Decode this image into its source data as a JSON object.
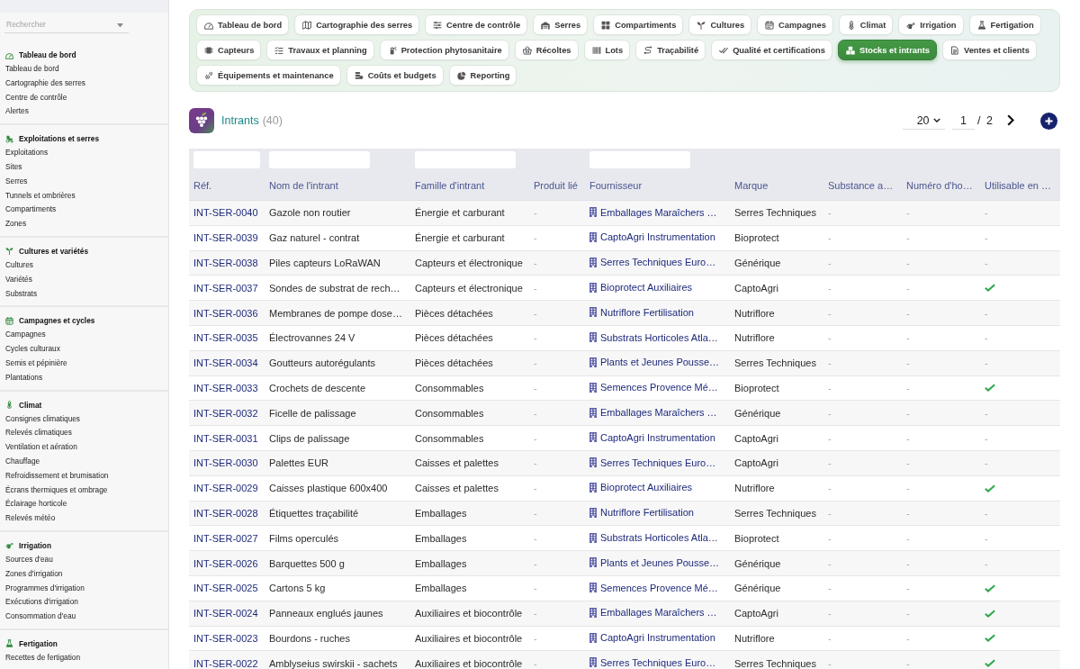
{
  "sidebar": {
    "search": {
      "placeholder": "Rechercher"
    },
    "sections": [
      {
        "title": "Tableau de bord",
        "items": [
          "Tableau de bord",
          "Cartographie des serres",
          "Centre de contrôle",
          "Alertes"
        ]
      },
      {
        "title": "Exploitations et serres",
        "items": [
          "Exploitations",
          "Sites",
          "Serres",
          "Tunnels et ombrières",
          "Compartiments",
          "Zones"
        ]
      },
      {
        "title": "Cultures et variétés",
        "items": [
          "Cultures",
          "Variétés",
          "Substrats"
        ]
      },
      {
        "title": "Campagnes et cycles",
        "items": [
          "Campagnes",
          "Cycles culturaux",
          "Semis et pépinière",
          "Plantations"
        ]
      },
      {
        "title": "Climat",
        "items": [
          "Consignes climatiques",
          "Relevés climatiques",
          "Ventilation et aération",
          "Chauffage",
          "Refroidissement et brumisation",
          "Écrans thermiques et ombrage",
          "Éclairage horticole",
          "Relevés météo"
        ]
      },
      {
        "title": "Irrigation",
        "items": [
          "Sources d'eau",
          "Zones d'irrigation",
          "Programmes d'irrigation",
          "Exécutions d'irrigation",
          "Consommation d'eau"
        ]
      },
      {
        "title": "Fertigation",
        "items": [
          "Recettes de fertigation"
        ]
      }
    ]
  },
  "nav_tabs": [
    {
      "label": "Tableau de bord",
      "selected": false
    },
    {
      "label": "Cartographie des serres",
      "selected": false
    },
    {
      "label": "Centre de contrôle",
      "selected": false
    },
    {
      "label": "Serres",
      "selected": false
    },
    {
      "label": "Compartiments",
      "selected": false
    },
    {
      "label": "Cultures",
      "selected": false
    },
    {
      "label": "Campagnes",
      "selected": false
    },
    {
      "label": "Climat",
      "selected": false
    },
    {
      "label": "Irrigation",
      "selected": false
    },
    {
      "label": "Fertigation",
      "selected": false
    },
    {
      "label": "Capteurs",
      "selected": false
    },
    {
      "label": "Travaux et planning",
      "selected": false
    },
    {
      "label": "Protection phytosanitaire",
      "selected": false
    },
    {
      "label": "Récoltes",
      "selected": false
    },
    {
      "label": "Lots",
      "selected": false
    },
    {
      "label": "Traçabilité",
      "selected": false
    },
    {
      "label": "Qualité et certifications",
      "selected": false
    },
    {
      "label": "Stocks et intrants",
      "selected": true
    },
    {
      "label": "Ventes et clients",
      "selected": false
    },
    {
      "label": "Équipements et maintenance",
      "selected": false
    },
    {
      "label": "Coûts et budgets",
      "selected": false
    },
    {
      "label": "Reporting",
      "selected": false
    }
  ],
  "header": {
    "title": "Intrants",
    "count": "(40)",
    "page_size": "20",
    "page": "1",
    "page_total": "/ 2"
  },
  "table": {
    "columns": [
      {
        "label": "Réf.",
        "filter": true
      },
      {
        "label": "Nom de l'intrant",
        "filter": true
      },
      {
        "label": "Famille d'intrant",
        "filter": true
      },
      {
        "label": "Produit lié",
        "filter": false
      },
      {
        "label": "Fournisseur",
        "filter": true
      },
      {
        "label": "Marque",
        "filter": false
      },
      {
        "label": "Substance a…",
        "filter": false
      },
      {
        "label": "Numéro d'ho…",
        "filter": false
      },
      {
        "label": "Utilisable en …",
        "filter": false
      }
    ],
    "rows": [
      {
        "ref": "INT-SER-0040",
        "name": "Gazole non routier",
        "family": "Énergie et carburant",
        "linked_product": "-",
        "supplier": "Emballages Maraîchers …",
        "brand": "Serres Techniques",
        "substance": "-",
        "number": "-",
        "usable": false,
        "usable_text": "-"
      },
      {
        "ref": "INT-SER-0039",
        "name": "Gaz naturel - contrat",
        "family": "Énergie et carburant",
        "linked_product": "-",
        "supplier": "CaptoAgri Instrumentation",
        "brand": "Bioprotect",
        "substance": "-",
        "number": "-",
        "usable": false,
        "usable_text": "-"
      },
      {
        "ref": "INT-SER-0038",
        "name": "Piles capteurs LoRaWAN",
        "family": "Capteurs et électronique",
        "linked_product": "-",
        "supplier": "Serres Techniques Euro…",
        "brand": "Générique",
        "substance": "-",
        "number": "-",
        "usable": false,
        "usable_text": "-"
      },
      {
        "ref": "INT-SER-0037",
        "name": "Sondes de substrat de rech…",
        "family": "Capteurs et électronique",
        "linked_product": "-",
        "supplier": "Bioprotect Auxiliaires",
        "brand": "CaptoAgri",
        "substance": "-",
        "number": "-",
        "usable": true
      },
      {
        "ref": "INT-SER-0036",
        "name": "Membranes de pompe dose…",
        "family": "Pièces détachées",
        "linked_product": "-",
        "supplier": "Nutriflore Fertilisation",
        "brand": "Nutriflore",
        "substance": "-",
        "number": "-",
        "usable": false,
        "usable_text": "-"
      },
      {
        "ref": "INT-SER-0035",
        "name": "Électrovannes 24 V",
        "family": "Pièces détachées",
        "linked_product": "-",
        "supplier": "Substrats Horticoles Atla…",
        "brand": "Nutriflore",
        "substance": "-",
        "number": "-",
        "usable": false,
        "usable_text": "-"
      },
      {
        "ref": "INT-SER-0034",
        "name": "Goutteurs autorégulants",
        "family": "Pièces détachées",
        "linked_product": "-",
        "supplier": "Plants et Jeunes Pousse…",
        "brand": "Serres Techniques",
        "substance": "-",
        "number": "-",
        "usable": false,
        "usable_text": "-"
      },
      {
        "ref": "INT-SER-0033",
        "name": "Crochets de descente",
        "family": "Consommables",
        "linked_product": "-",
        "supplier": "Semences Provence Mé…",
        "brand": "Bioprotect",
        "substance": "-",
        "number": "-",
        "usable": true
      },
      {
        "ref": "INT-SER-0032",
        "name": "Ficelle de palissage",
        "family": "Consommables",
        "linked_product": "-",
        "supplier": "Emballages Maraîchers …",
        "brand": "Générique",
        "substance": "-",
        "number": "-",
        "usable": false,
        "usable_text": "-"
      },
      {
        "ref": "INT-SER-0031",
        "name": "Clips de palissage",
        "family": "Consommables",
        "linked_product": "-",
        "supplier": "CaptoAgri Instrumentation",
        "brand": "CaptoAgri",
        "substance": "-",
        "number": "-",
        "usable": false,
        "usable_text": "-"
      },
      {
        "ref": "INT-SER-0030",
        "name": "Palettes EUR",
        "family": "Caisses et palettes",
        "linked_product": "-",
        "supplier": "Serres Techniques Euro…",
        "brand": "CaptoAgri",
        "substance": "-",
        "number": "-",
        "usable": false,
        "usable_text": "-"
      },
      {
        "ref": "INT-SER-0029",
        "name": "Caisses plastique 600x400",
        "family": "Caisses et palettes",
        "linked_product": "-",
        "supplier": "Bioprotect Auxiliaires",
        "brand": "Nutriflore",
        "substance": "-",
        "number": "-",
        "usable": true
      },
      {
        "ref": "INT-SER-0028",
        "name": "Étiquettes traçabilité",
        "family": "Emballages",
        "linked_product": "-",
        "supplier": "Nutriflore Fertilisation",
        "brand": "Serres Techniques",
        "substance": "-",
        "number": "-",
        "usable": false,
        "usable_text": "-"
      },
      {
        "ref": "INT-SER-0027",
        "name": "Films operculés",
        "family": "Emballages",
        "linked_product": "-",
        "supplier": "Substrats Horticoles Atla…",
        "brand": "Bioprotect",
        "substance": "-",
        "number": "-",
        "usable": false,
        "usable_text": "-"
      },
      {
        "ref": "INT-SER-0026",
        "name": "Barquettes 500 g",
        "family": "Emballages",
        "linked_product": "-",
        "supplier": "Plants et Jeunes Pousse…",
        "brand": "Générique",
        "substance": "-",
        "number": "-",
        "usable": false,
        "usable_text": "-"
      },
      {
        "ref": "INT-SER-0025",
        "name": "Cartons 5 kg",
        "family": "Emballages",
        "linked_product": "-",
        "supplier": "Semences Provence Mé…",
        "brand": "Générique",
        "substance": "-",
        "number": "-",
        "usable": true
      },
      {
        "ref": "INT-SER-0024",
        "name": "Panneaux englués jaunes",
        "family": "Auxiliaires et biocontrôle",
        "linked_product": "-",
        "supplier": "Emballages Maraîchers …",
        "brand": "CaptoAgri",
        "substance": "-",
        "number": "-",
        "usable": true
      },
      {
        "ref": "INT-SER-0023",
        "name": "Bourdons - ruches",
        "family": "Auxiliaires et biocontrôle",
        "linked_product": "-",
        "supplier": "CaptoAgri Instrumentation",
        "brand": "Nutriflore",
        "substance": "-",
        "number": "-",
        "usable": true
      },
      {
        "ref": "INT-SER-0022",
        "name": "Amblyseius swirskii - sachets",
        "family": "Auxiliaires et biocontrôle",
        "linked_product": "-",
        "supplier": "Serres Techniques Euro…",
        "brand": "Serres Techniques",
        "substance": "-",
        "number": "-",
        "usable": true
      }
    ]
  }
}
